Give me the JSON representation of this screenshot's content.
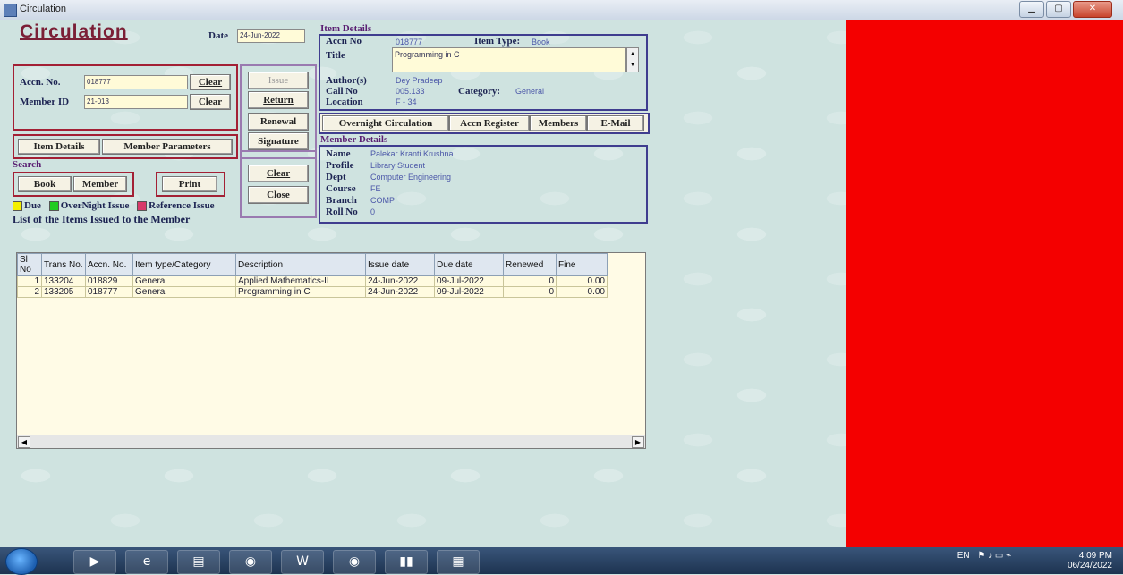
{
  "window": {
    "title": "Circulation"
  },
  "header": {
    "heading": "Circulation",
    "date_label": "Date",
    "date_value": "24-Jun-2022"
  },
  "accn_section": {
    "accn_label": "Accn. No.",
    "accn_value": "018777",
    "clear1": "Clear",
    "member_label": "Member ID",
    "member_value": "21-013",
    "clear2": "Clear"
  },
  "actions": {
    "issue": "Issue",
    "return": "Return",
    "renewal": "Renewal",
    "signature": "Signature",
    "clear": "Clear",
    "close": "Close"
  },
  "tabs_left": {
    "item_details": "Item Details",
    "member_parameters": "Member Parameters"
  },
  "search": {
    "label": "Search",
    "book": "Book",
    "member": "Member",
    "print": "Print"
  },
  "legend": {
    "due": "Due",
    "overnight": "OverNight Issue",
    "reference": "Reference Issue",
    "colors": {
      "due": "#f4f000",
      "overnight": "#22cc22",
      "reference": "#d83a6a"
    }
  },
  "list_title": "List of the Items Issued to the Member",
  "item_details": {
    "section": "Item Details",
    "accn_label": "Accn No",
    "accn_value": "018777",
    "type_label": "Item Type:",
    "type_value": "Book",
    "title_label": "Title",
    "title_value": "Programming in C",
    "author_label": "Author(s)",
    "author_value": "Dey Pradeep",
    "callno_label": "Call No",
    "callno_value": "005.133",
    "category_label": "Category:",
    "category_value": "General",
    "location_label": "Location",
    "location_value": "F - 34"
  },
  "toolbar": {
    "overnight": "Overnight Circulation",
    "accn_register": "Accn Register",
    "members": "Members",
    "email": "E-Mail"
  },
  "member_details": {
    "section": "Member Details",
    "name_label": "Name",
    "name_value": "Palekar Kranti Krushna",
    "profile_label": "Profile",
    "profile_value": "Library Student",
    "dept_label": "Dept",
    "dept_value": "Computer Engineering",
    "course_label": "Course",
    "course_value": "FE",
    "branch_label": "Branch",
    "branch_value": "COMP",
    "roll_label": "Roll No",
    "roll_value": "0"
  },
  "grid": {
    "columns": [
      "Sl No",
      "Trans No.",
      "Accn. No.",
      "Item type/Category",
      "Description",
      "Issue date",
      "Due date",
      "Renewed",
      "Fine"
    ],
    "rows": [
      [
        "1",
        "133204",
        "018829",
        "General",
        "Applied Mathematics-II",
        "24-Jun-2022",
        "09-Jul-2022",
        "0",
        "0.00"
      ],
      [
        "2",
        "133205",
        "018777",
        "General",
        "Programming in C",
        "24-Jun-2022",
        "09-Jul-2022",
        "0",
        "0.00"
      ]
    ]
  },
  "taskbar": {
    "lang": "EN",
    "time": "4:09 PM",
    "date": "06/24/2022"
  }
}
